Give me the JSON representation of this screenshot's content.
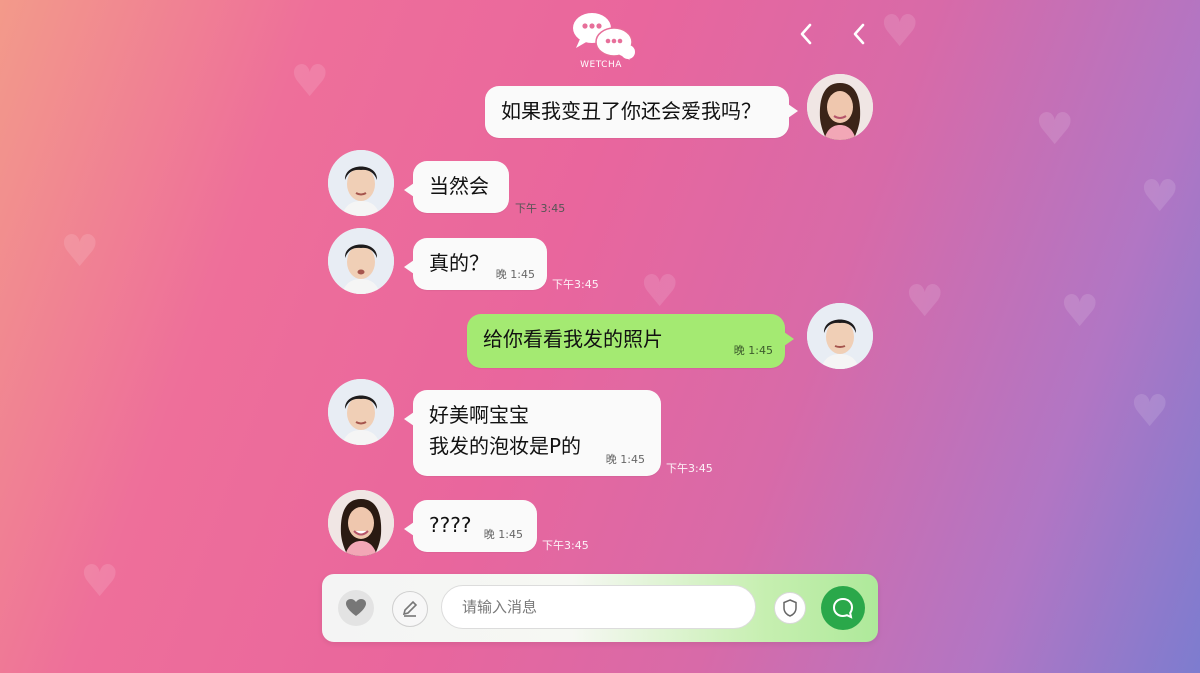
{
  "app": {
    "logo_text": "WETCHA"
  },
  "theme": {
    "bubble": "#fafafa",
    "bubble_self_green": "#a4ea72",
    "send": "#2aa84a"
  },
  "messages": [
    {
      "text": "如果我变丑了你还会爱我吗？"
    },
    {
      "text": "当然会",
      "meta": "下午 3:45"
    },
    {
      "text": "真的？",
      "inner_meta": "晚 1:45",
      "meta": "下午3:45"
    },
    {
      "text": "给你看看我发的照片",
      "inner_meta": "晚 1:45"
    },
    {
      "line1": "好美啊宝宝",
      "line2": "我发的泡妆是P的",
      "inner_meta": "晚 1:45",
      "meta": "下午3:45"
    },
    {
      "text": "????",
      "inner_meta": "晚 1:45",
      "meta": "下午3:45"
    }
  ],
  "composer": {
    "placeholder": "请输入消息",
    "icons": [
      "heart-icon",
      "edit-icon",
      "shield-icon",
      "send-icon"
    ]
  }
}
